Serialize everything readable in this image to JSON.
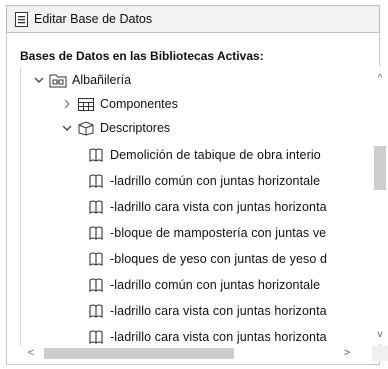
{
  "window": {
    "title": "Editar Base de Datos"
  },
  "tree_header": "Bases de Datos en las Bibliotecas Activas:",
  "tree": {
    "root": {
      "label": "Albañilería",
      "expanded": true
    },
    "componentes": {
      "label": "Componentes",
      "expanded": false
    },
    "descriptores": {
      "label": "Descriptores",
      "expanded": true
    },
    "items": [
      "Demolición de tabique de obra interio",
      "-ladrillo común con juntas horizontale",
      "-ladrillo cara vista con juntas horizonta",
      "-bloque de mampostería con juntas ve",
      "-bloques de yeso con juntas de yeso d",
      "-ladrillo común con juntas horizontale",
      "-ladrillo cara vista con juntas horizonta",
      "-ladrillo cara vista con juntas horizonta"
    ]
  },
  "icons": {
    "window": "database-window-icon",
    "expanded": "chevron-down-icon",
    "collapsed": "chevron-right-icon",
    "root": "folder-database-icon",
    "componentes": "components-grid-icon",
    "descriptores": "descriptors-box-icon",
    "item": "book-icon"
  },
  "scrollbars": {
    "up": "^",
    "down": "v",
    "left": "<",
    "right": ">"
  }
}
